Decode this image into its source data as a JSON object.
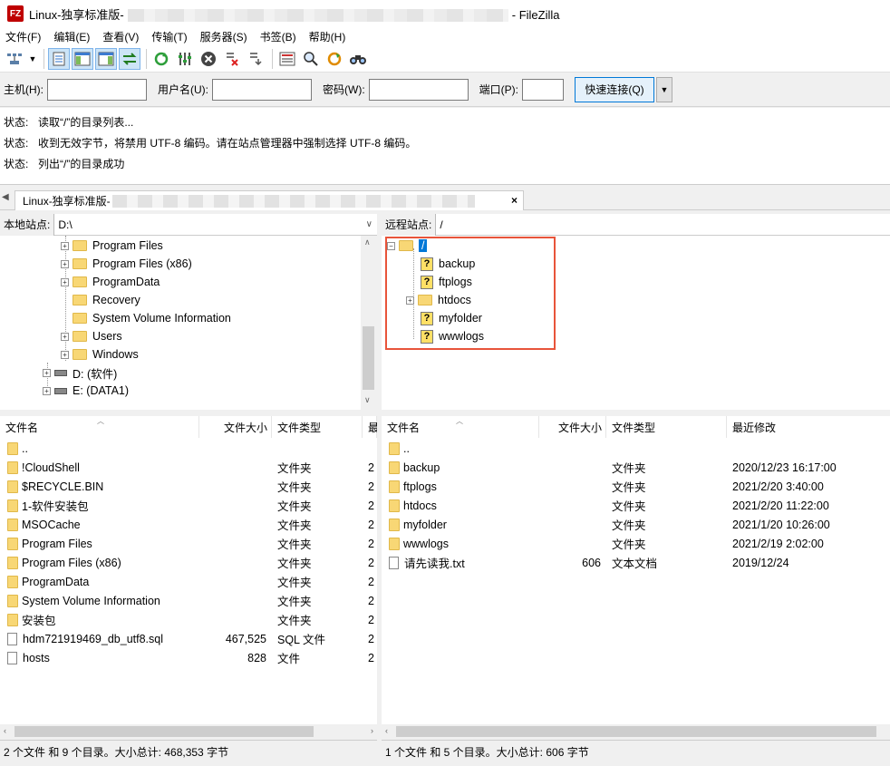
{
  "window": {
    "title_prefix": "Linux-独享标准版-",
    "title_suffix": "- FileZilla",
    "app_icon_text": "FZ"
  },
  "menu": [
    "文件(F)",
    "编辑(E)",
    "查看(V)",
    "传输(T)",
    "服务器(S)",
    "书签(B)",
    "帮助(H)"
  ],
  "toolbar_icons": [
    "site-manager-icon",
    "dropdown-arrow-icon",
    "message-log-toggle-icon",
    "local-tree-toggle-icon",
    "remote-tree-toggle-icon",
    "transfer-queue-toggle-icon",
    "refresh-icon",
    "process-queue-icon",
    "cancel-icon",
    "disconnect-icon",
    "reconnect-icon",
    "filter-icon",
    "search-icon",
    "sync-browse-icon",
    "find-binoculars-icon"
  ],
  "quickconnect": {
    "host_label": "主机(H):",
    "user_label": "用户名(U):",
    "pass_label": "密码(W):",
    "port_label": "端口(P):",
    "host_value": "",
    "user_value": "",
    "pass_value": "",
    "port_value": "",
    "button_label": "快速连接(Q)"
  },
  "log": [
    {
      "label": "状态:",
      "text": "读取“/”的目录列表..."
    },
    {
      "label": "状态:",
      "text": "收到无效字节，将禁用 UTF-8 编码。请在站点管理器中强制选择 UTF-8 编码。"
    },
    {
      "label": "状态:",
      "text": "列出“/”的目录成功"
    }
  ],
  "tab": {
    "label": "Linux-独享标准版-",
    "close": "×"
  },
  "local": {
    "path_label": "本地站点:",
    "path_value": "D:\\",
    "tree": [
      {
        "name": "Program Files",
        "expander": "+"
      },
      {
        "name": "Program Files (x86)",
        "expander": "+"
      },
      {
        "name": "ProgramData",
        "expander": "+"
      },
      {
        "name": "Recovery",
        "expander": ""
      },
      {
        "name": "System Volume Information",
        "expander": ""
      },
      {
        "name": "Users",
        "expander": "+"
      },
      {
        "name": "Windows",
        "expander": "+"
      },
      {
        "name": "D: (软件)",
        "expander": "+"
      },
      {
        "name": "E: (DATA1)",
        "expander": "+"
      }
    ],
    "columns": [
      "文件名",
      "文件大小",
      "文件类型",
      "最"
    ],
    "files": [
      {
        "name": "..",
        "size": "",
        "type": "",
        "mod": ""
      },
      {
        "name": "!CloudShell",
        "size": "",
        "type": "文件夹",
        "mod": "2"
      },
      {
        "name": "$RECYCLE.BIN",
        "size": "",
        "type": "文件夹",
        "mod": "2"
      },
      {
        "name": "1-软件安装包",
        "size": "",
        "type": "文件夹",
        "mod": "2"
      },
      {
        "name": "MSOCache",
        "size": "",
        "type": "文件夹",
        "mod": "2"
      },
      {
        "name": "Program Files",
        "size": "",
        "type": "文件夹",
        "mod": "2"
      },
      {
        "name": "Program Files (x86)",
        "size": "",
        "type": "文件夹",
        "mod": "2"
      },
      {
        "name": "ProgramData",
        "size": "",
        "type": "文件夹",
        "mod": "2"
      },
      {
        "name": "System Volume Information",
        "size": "",
        "type": "文件夹",
        "mod": "2"
      },
      {
        "name": "安装包",
        "size": "",
        "type": "文件夹",
        "mod": "2"
      },
      {
        "name": "hdm721919469_db_utf8.sql",
        "size": "467,525",
        "type": "SQL 文件",
        "mod": "2"
      },
      {
        "name": "hosts",
        "size": "828",
        "type": "文件",
        "mod": "2"
      }
    ],
    "status": "2 个文件 和 9 个目录。大小总计: 468,353 字节"
  },
  "remote": {
    "path_label": "远程站点:",
    "path_value": "/",
    "tree_root": "/",
    "tree": [
      {
        "name": "backup",
        "icon": "unknown"
      },
      {
        "name": "ftplogs",
        "icon": "unknown"
      },
      {
        "name": "htdocs",
        "icon": "folder"
      },
      {
        "name": "myfolder",
        "icon": "unknown"
      },
      {
        "name": "wwwlogs",
        "icon": "unknown"
      }
    ],
    "columns": [
      "文件名",
      "文件大小",
      "文件类型",
      "最近修改"
    ],
    "files": [
      {
        "name": "..",
        "size": "",
        "type": "",
        "mod": ""
      },
      {
        "name": "backup",
        "size": "",
        "type": "文件夹",
        "mod": "2020/12/23 16:17:00"
      },
      {
        "name": "ftplogs",
        "size": "",
        "type": "文件夹",
        "mod": "2021/2/20 3:40:00"
      },
      {
        "name": "htdocs",
        "size": "",
        "type": "文件夹",
        "mod": "2021/2/20 11:22:00"
      },
      {
        "name": "myfolder",
        "size": "",
        "type": "文件夹",
        "mod": "2021/1/20 10:26:00"
      },
      {
        "name": "wwwlogs",
        "size": "",
        "type": "文件夹",
        "mod": "2021/2/19 2:02:00"
      },
      {
        "name": "请先读我.txt",
        "size": "606",
        "type": "文本文档",
        "mod": "2019/12/24"
      }
    ],
    "status": "1 个文件 和 5 个目录。大小总计: 606 字节"
  }
}
